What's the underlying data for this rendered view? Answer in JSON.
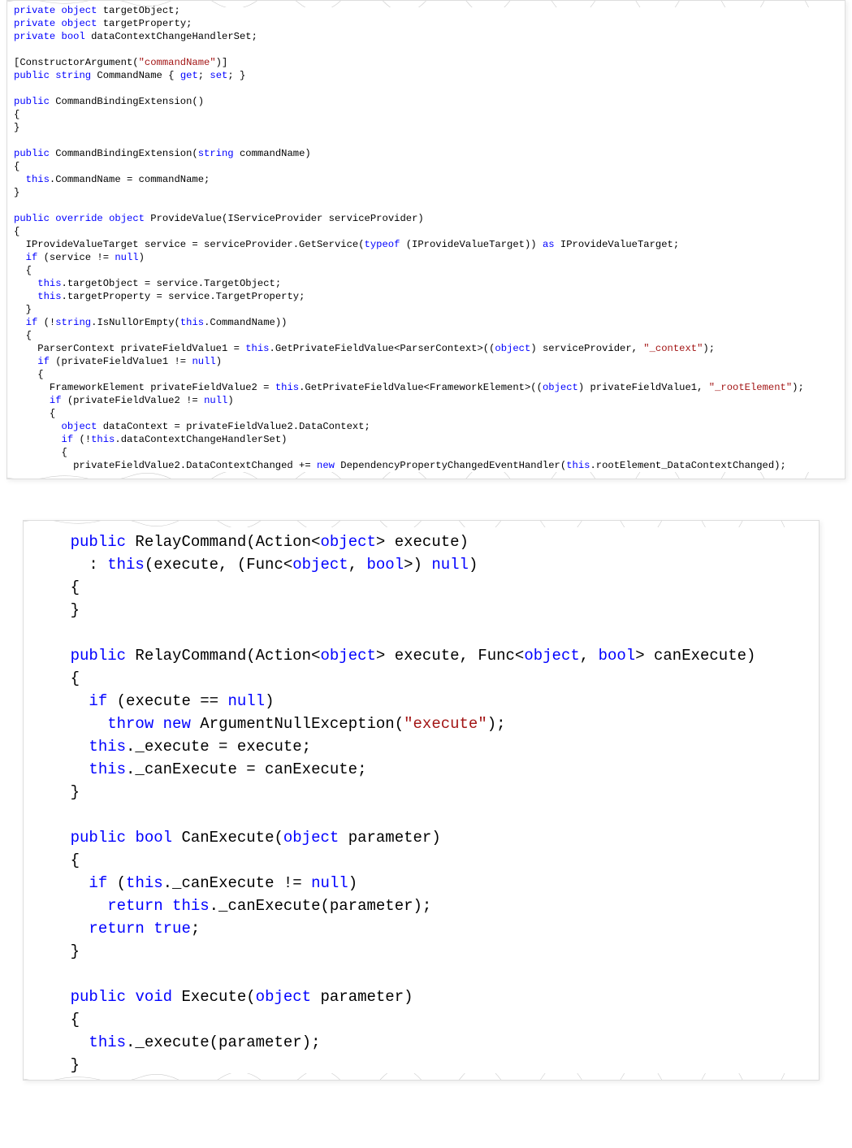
{
  "colors": {
    "keyword": "#0000ff",
    "string": "#a31515",
    "type": "#2b91af",
    "text": "#000000",
    "background": "#ffffff"
  },
  "block1": {
    "language": "csharp",
    "tokens": [
      [
        [
          "kw",
          "private"
        ],
        [
          "txt",
          " "
        ],
        [
          "kw",
          "object"
        ],
        [
          "txt",
          " targetObject;"
        ]
      ],
      [
        [
          "kw",
          "private"
        ],
        [
          "txt",
          " "
        ],
        [
          "kw",
          "object"
        ],
        [
          "txt",
          " targetProperty;"
        ]
      ],
      [
        [
          "kw",
          "private"
        ],
        [
          "txt",
          " "
        ],
        [
          "kw",
          "bool"
        ],
        [
          "txt",
          " dataContextChangeHandlerSet;"
        ]
      ],
      [
        [
          "txt",
          ""
        ]
      ],
      [
        [
          "txt",
          "[ConstructorArgument("
        ],
        [
          "str",
          "\"commandName\""
        ],
        [
          "txt",
          ")]"
        ]
      ],
      [
        [
          "kw",
          "public"
        ],
        [
          "txt",
          " "
        ],
        [
          "kw",
          "string"
        ],
        [
          "txt",
          " CommandName { "
        ],
        [
          "kw",
          "get"
        ],
        [
          "txt",
          "; "
        ],
        [
          "kw",
          "set"
        ],
        [
          "txt",
          "; }"
        ]
      ],
      [
        [
          "txt",
          ""
        ]
      ],
      [
        [
          "kw",
          "public"
        ],
        [
          "txt",
          " CommandBindingExtension()"
        ]
      ],
      [
        [
          "txt",
          "{"
        ]
      ],
      [
        [
          "txt",
          "}"
        ]
      ],
      [
        [
          "txt",
          ""
        ]
      ],
      [
        [
          "kw",
          "public"
        ],
        [
          "txt",
          " CommandBindingExtension("
        ],
        [
          "kw",
          "string"
        ],
        [
          "txt",
          " commandName)"
        ]
      ],
      [
        [
          "txt",
          "{"
        ]
      ],
      [
        [
          "txt",
          "  "
        ],
        [
          "kw",
          "this"
        ],
        [
          "txt",
          ".CommandName = commandName;"
        ]
      ],
      [
        [
          "txt",
          "}"
        ]
      ],
      [
        [
          "txt",
          ""
        ]
      ],
      [
        [
          "kw",
          "public"
        ],
        [
          "txt",
          " "
        ],
        [
          "kw",
          "override"
        ],
        [
          "txt",
          " "
        ],
        [
          "kw",
          "object"
        ],
        [
          "txt",
          " ProvideValue(IServiceProvider serviceProvider)"
        ]
      ],
      [
        [
          "txt",
          "{"
        ]
      ],
      [
        [
          "txt",
          "  IProvideValueTarget service = serviceProvider.GetService("
        ],
        [
          "kw",
          "typeof"
        ],
        [
          "txt",
          " (IProvideValueTarget)) "
        ],
        [
          "kw",
          "as"
        ],
        [
          "txt",
          " IProvideValueTarget;"
        ]
      ],
      [
        [
          "txt",
          "  "
        ],
        [
          "kw",
          "if"
        ],
        [
          "txt",
          " (service != "
        ],
        [
          "kw",
          "null"
        ],
        [
          "txt",
          ")"
        ]
      ],
      [
        [
          "txt",
          "  {"
        ]
      ],
      [
        [
          "txt",
          "    "
        ],
        [
          "kw",
          "this"
        ],
        [
          "txt",
          ".targetObject = service.TargetObject;"
        ]
      ],
      [
        [
          "txt",
          "    "
        ],
        [
          "kw",
          "this"
        ],
        [
          "txt",
          ".targetProperty = service.TargetProperty;"
        ]
      ],
      [
        [
          "txt",
          "  }"
        ]
      ],
      [
        [
          "txt",
          "  "
        ],
        [
          "kw",
          "if"
        ],
        [
          "txt",
          " (!"
        ],
        [
          "kw",
          "string"
        ],
        [
          "txt",
          ".IsNullOrEmpty("
        ],
        [
          "kw",
          "this"
        ],
        [
          "txt",
          ".CommandName))"
        ]
      ],
      [
        [
          "txt",
          "  {"
        ]
      ],
      [
        [
          "txt",
          "    ParserContext privateFieldValue1 = "
        ],
        [
          "kw",
          "this"
        ],
        [
          "txt",
          ".GetPrivateFieldValue<ParserContext>(("
        ],
        [
          "kw",
          "object"
        ],
        [
          "txt",
          ") serviceProvider, "
        ],
        [
          "str",
          "\"_context\""
        ],
        [
          "txt",
          ");"
        ]
      ],
      [
        [
          "txt",
          "    "
        ],
        [
          "kw",
          "if"
        ],
        [
          "txt",
          " (privateFieldValue1 != "
        ],
        [
          "kw",
          "null"
        ],
        [
          "txt",
          ")"
        ]
      ],
      [
        [
          "txt",
          "    {"
        ]
      ],
      [
        [
          "txt",
          "      FrameworkElement privateFieldValue2 = "
        ],
        [
          "kw",
          "this"
        ],
        [
          "txt",
          ".GetPrivateFieldValue<FrameworkElement>(("
        ],
        [
          "kw",
          "object"
        ],
        [
          "txt",
          ") privateFieldValue1, "
        ],
        [
          "str",
          "\"_rootElement\""
        ],
        [
          "txt",
          ");"
        ]
      ],
      [
        [
          "txt",
          "      "
        ],
        [
          "kw",
          "if"
        ],
        [
          "txt",
          " (privateFieldValue2 != "
        ],
        [
          "kw",
          "null"
        ],
        [
          "txt",
          ")"
        ]
      ],
      [
        [
          "txt",
          "      {"
        ]
      ],
      [
        [
          "txt",
          "        "
        ],
        [
          "kw",
          "object"
        ],
        [
          "txt",
          " dataContext = privateFieldValue2.DataContext;"
        ]
      ],
      [
        [
          "txt",
          "        "
        ],
        [
          "kw",
          "if"
        ],
        [
          "txt",
          " (!"
        ],
        [
          "kw",
          "this"
        ],
        [
          "txt",
          ".dataContextChangeHandlerSet)"
        ]
      ],
      [
        [
          "txt",
          "        {"
        ]
      ],
      [
        [
          "txt",
          "          privateFieldValue2.DataContextChanged += "
        ],
        [
          "kw",
          "new"
        ],
        [
          "txt",
          " DependencyPropertyChangedEventHandler("
        ],
        [
          "kw",
          "this"
        ],
        [
          "txt",
          ".rootElement_DataContextChanged);"
        ]
      ]
    ]
  },
  "block2": {
    "language": "csharp",
    "tokens": [
      [
        [
          "txt",
          "    "
        ],
        [
          "kw",
          "public"
        ],
        [
          "txt",
          " RelayCommand(Action<"
        ],
        [
          "kw",
          "object"
        ],
        [
          "txt",
          "> execute)"
        ]
      ],
      [
        [
          "txt",
          "      : "
        ],
        [
          "kw",
          "this"
        ],
        [
          "txt",
          "(execute, (Func<"
        ],
        [
          "kw",
          "object"
        ],
        [
          "txt",
          ", "
        ],
        [
          "kw",
          "bool"
        ],
        [
          "txt",
          ">) "
        ],
        [
          "kw",
          "null"
        ],
        [
          "txt",
          ")"
        ]
      ],
      [
        [
          "txt",
          "    {"
        ]
      ],
      [
        [
          "txt",
          "    }"
        ]
      ],
      [
        [
          "txt",
          ""
        ]
      ],
      [
        [
          "txt",
          "    "
        ],
        [
          "kw",
          "public"
        ],
        [
          "txt",
          " RelayCommand(Action<"
        ],
        [
          "kw",
          "object"
        ],
        [
          "txt",
          "> execute, Func<"
        ],
        [
          "kw",
          "object"
        ],
        [
          "txt",
          ", "
        ],
        [
          "kw",
          "bool"
        ],
        [
          "txt",
          "> canExecute)"
        ]
      ],
      [
        [
          "txt",
          "    {"
        ]
      ],
      [
        [
          "txt",
          "      "
        ],
        [
          "kw",
          "if"
        ],
        [
          "txt",
          " (execute == "
        ],
        [
          "kw",
          "null"
        ],
        [
          "txt",
          ")"
        ]
      ],
      [
        [
          "txt",
          "        "
        ],
        [
          "kw",
          "throw"
        ],
        [
          "txt",
          " "
        ],
        [
          "kw",
          "new"
        ],
        [
          "txt",
          " ArgumentNullException("
        ],
        [
          "str",
          "\"execute\""
        ],
        [
          "txt",
          ");"
        ]
      ],
      [
        [
          "txt",
          "      "
        ],
        [
          "kw",
          "this"
        ],
        [
          "txt",
          "._execute = execute;"
        ]
      ],
      [
        [
          "txt",
          "      "
        ],
        [
          "kw",
          "this"
        ],
        [
          "txt",
          "._canExecute = canExecute;"
        ]
      ],
      [
        [
          "txt",
          "    }"
        ]
      ],
      [
        [
          "txt",
          ""
        ]
      ],
      [
        [
          "txt",
          "    "
        ],
        [
          "kw",
          "public"
        ],
        [
          "txt",
          " "
        ],
        [
          "kw",
          "bool"
        ],
        [
          "txt",
          " CanExecute("
        ],
        [
          "kw",
          "object"
        ],
        [
          "txt",
          " parameter)"
        ]
      ],
      [
        [
          "txt",
          "    {"
        ]
      ],
      [
        [
          "txt",
          "      "
        ],
        [
          "kw",
          "if"
        ],
        [
          "txt",
          " ("
        ],
        [
          "kw",
          "this"
        ],
        [
          "txt",
          "._canExecute != "
        ],
        [
          "kw",
          "null"
        ],
        [
          "txt",
          ")"
        ]
      ],
      [
        [
          "txt",
          "        "
        ],
        [
          "kw",
          "return"
        ],
        [
          "txt",
          " "
        ],
        [
          "kw",
          "this"
        ],
        [
          "txt",
          "._canExecute(parameter);"
        ]
      ],
      [
        [
          "txt",
          "      "
        ],
        [
          "kw",
          "return"
        ],
        [
          "txt",
          " "
        ],
        [
          "kw",
          "true"
        ],
        [
          "txt",
          ";"
        ]
      ],
      [
        [
          "txt",
          "    }"
        ]
      ],
      [
        [
          "txt",
          ""
        ]
      ],
      [
        [
          "txt",
          "    "
        ],
        [
          "kw",
          "public"
        ],
        [
          "txt",
          " "
        ],
        [
          "kw",
          "void"
        ],
        [
          "txt",
          " Execute("
        ],
        [
          "kw",
          "object"
        ],
        [
          "txt",
          " parameter)"
        ]
      ],
      [
        [
          "txt",
          "    {"
        ]
      ],
      [
        [
          "txt",
          "      "
        ],
        [
          "kw",
          "this"
        ],
        [
          "txt",
          "._execute(parameter);"
        ]
      ],
      [
        [
          "txt",
          "    }"
        ]
      ]
    ]
  }
}
